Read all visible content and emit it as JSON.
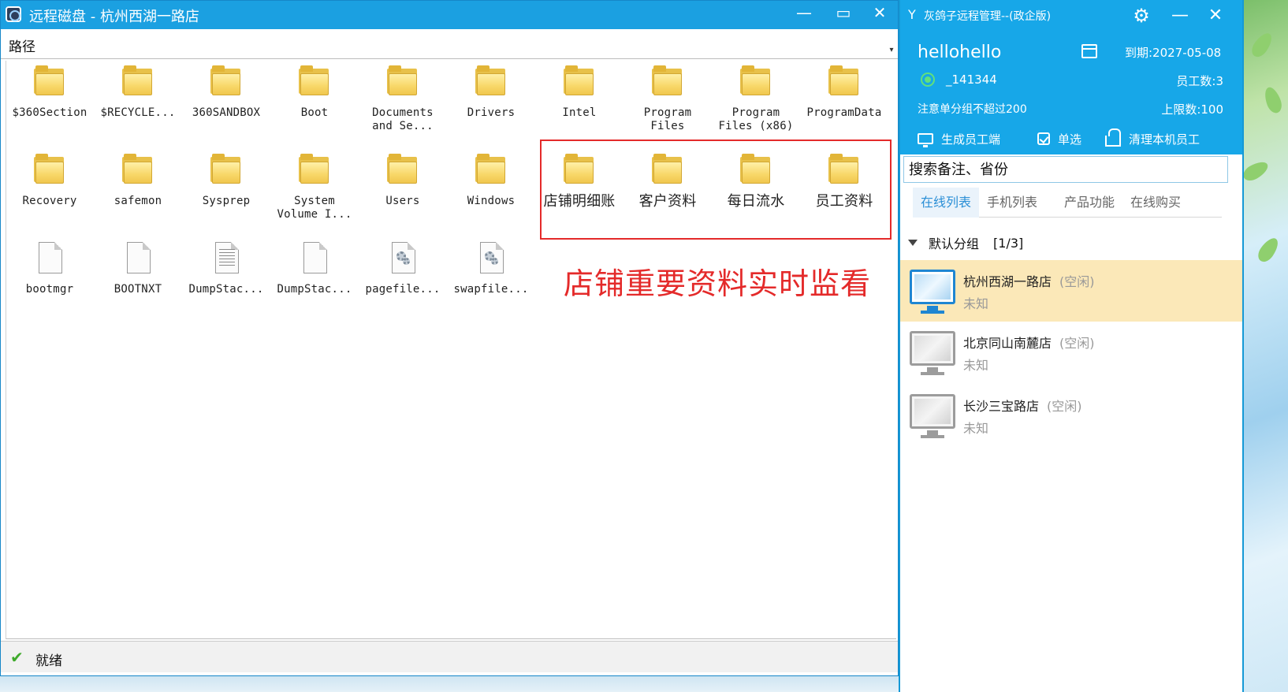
{
  "disk_window": {
    "title": "远程磁盘 - 杭州西湖一路店",
    "controls": {
      "minimize": "—",
      "maximize": "▭",
      "close": "✕"
    },
    "path_label": "路径",
    "items": [
      {
        "label": "$360Section",
        "type": "folder"
      },
      {
        "label": "$RECYCLE...",
        "type": "folder"
      },
      {
        "label": "360SANDBOX",
        "type": "folder"
      },
      {
        "label": "Boot",
        "type": "folder"
      },
      {
        "label": "Documents\nand Se...",
        "type": "folder"
      },
      {
        "label": "Drivers",
        "type": "folder"
      },
      {
        "label": "Intel",
        "type": "folder"
      },
      {
        "label": "Program\nFiles",
        "type": "folder"
      },
      {
        "label": "Program\nFiles (x86)",
        "type": "folder"
      },
      {
        "label": "ProgramData",
        "type": "folder"
      },
      {
        "label": "Recovery",
        "type": "folder"
      },
      {
        "label": "safemon",
        "type": "folder"
      },
      {
        "label": "Sysprep",
        "type": "folder"
      },
      {
        "label": "System\nVolume I...",
        "type": "folder"
      },
      {
        "label": "Users",
        "type": "folder"
      },
      {
        "label": "Windows",
        "type": "folder"
      },
      {
        "label": "店铺明细账",
        "type": "folder"
      },
      {
        "label": "客户资料",
        "type": "folder"
      },
      {
        "label": "每日流水",
        "type": "folder"
      },
      {
        "label": "员工资料",
        "type": "folder"
      },
      {
        "label": "bootmgr",
        "type": "file"
      },
      {
        "label": "BOOTNXT",
        "type": "file"
      },
      {
        "label": "DumpStac...",
        "type": "text-file"
      },
      {
        "label": "DumpStac...",
        "type": "file"
      },
      {
        "label": "pagefile...",
        "type": "system-file"
      },
      {
        "label": "swapfile...",
        "type": "system-file"
      }
    ],
    "overlay_caption": "店铺重要资料实时监看",
    "status_text": "就绪"
  },
  "manager": {
    "app_title": "灰鸽子远程管理--(政企版)",
    "username": "hellohello",
    "expiry": "到期:2027-05-08",
    "user_id": "_141344",
    "staff_count": "员工数:3",
    "notice": "注意单分组不超过200",
    "limit": "上限数:100",
    "actions": {
      "generate": "生成员工端",
      "single_select": "单选",
      "clean": "清理本机员工"
    },
    "search_placeholder": "搜索备注、省份",
    "tabs": [
      "在线列表",
      "手机列表",
      "产品功能",
      "在线购买"
    ],
    "group": {
      "name": "默认分组",
      "count": "[1/3]"
    },
    "devices": [
      {
        "name": "杭州西湖一路店",
        "status": "(空闲)",
        "sub": "未知",
        "selected": true
      },
      {
        "name": "北京同山南麓店",
        "status": "(空闲)",
        "sub": "未知",
        "selected": false
      },
      {
        "name": "长沙三宝路店",
        "status": "(空闲)",
        "sub": "未知",
        "selected": false
      }
    ]
  },
  "colors": {
    "titlebar": "#1ba0e1",
    "manager_header": "#17a7e8",
    "highlight_red": "#e42a2a",
    "selected_row": "#fbe8b8",
    "active_tab_text": "#2b8fd6"
  }
}
